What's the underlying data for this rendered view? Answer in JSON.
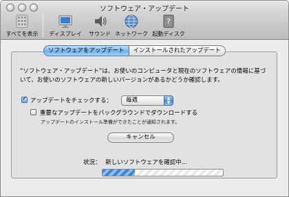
{
  "window": {
    "title": "ソフトウェア・アップデート"
  },
  "toolbar": {
    "show_all": "すべてを表示",
    "items": [
      {
        "label": "ディスプレイ",
        "icon": "display-icon"
      },
      {
        "label": "サウンド",
        "icon": "speaker-icon"
      },
      {
        "label": "ネットワーク",
        "icon": "globe-icon"
      },
      {
        "label": "起動ディスク",
        "icon": "startup-disk-icon"
      }
    ]
  },
  "tabs": [
    {
      "label": "ソフトウェアをアップデート",
      "selected": true
    },
    {
      "label": "インストールされたアップデート",
      "selected": false
    }
  ],
  "description": "“ソフトウェア・アップデート”は、お使いのコンピュータと現在のソフトウェアの情報に基づいて、お使いのソフトウェアの新しいバージョンがあるかどうか確認します。",
  "check_updates": {
    "label": "アップデートをチェックする：",
    "checked": true,
    "frequency": "毎週"
  },
  "background_download": {
    "label": "重要なアップデートをバックグラウンドでダウンロードする",
    "checked": false,
    "note": "アップデートのインストール準備ができたことが通知されます。"
  },
  "cancel_button": "キャンセル",
  "status": {
    "label": "状況：",
    "text": "新しいソフトウェアを確認中...",
    "progress": 0.27
  },
  "colors": {
    "accent": "#4a8fd9"
  }
}
